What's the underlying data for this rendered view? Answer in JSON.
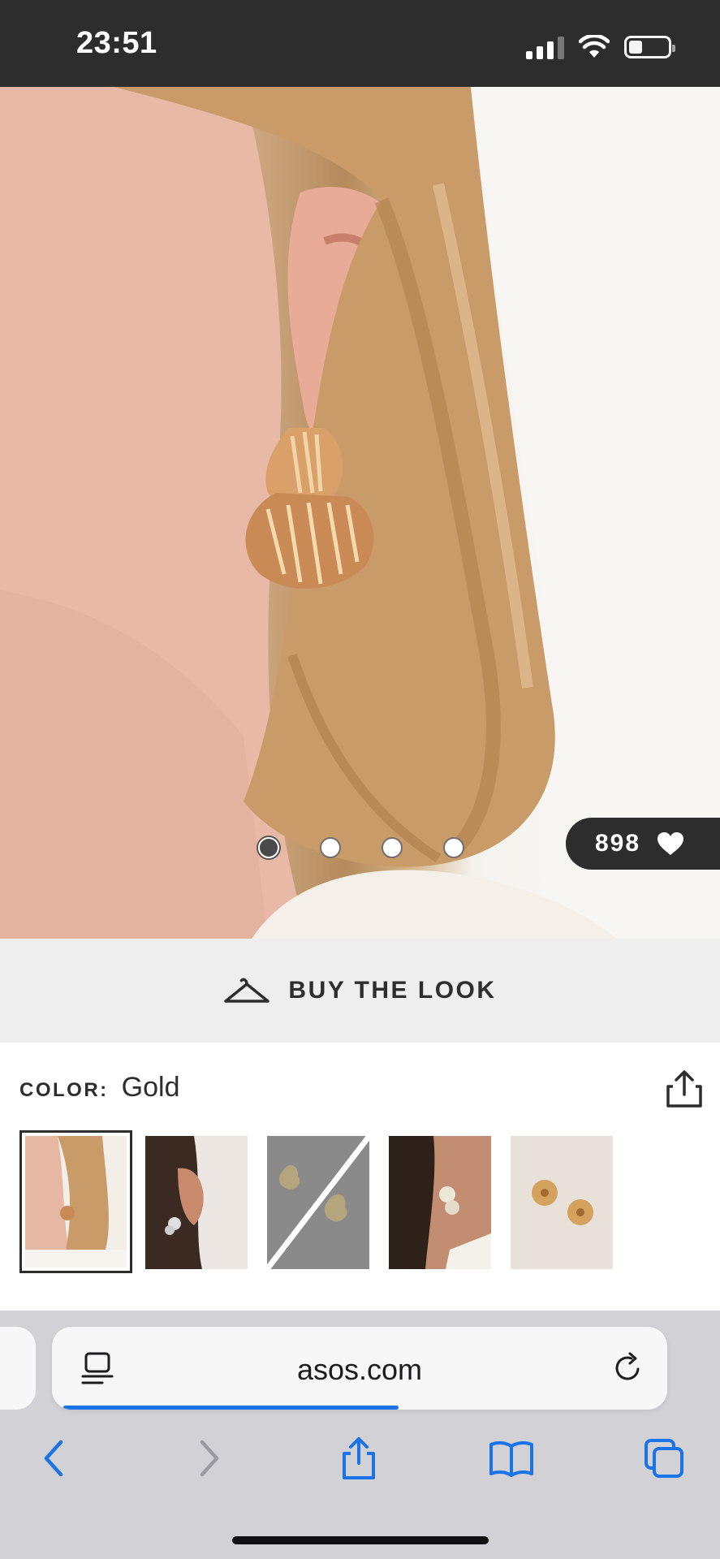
{
  "status_bar": {
    "time": "23:51",
    "icons": [
      "cellular-signal-icon",
      "wifi-icon",
      "battery-icon"
    ],
    "battery_level": 0.35
  },
  "product": {
    "gallery": {
      "image_count": 4,
      "active_index": 0
    },
    "likes": {
      "count": "898",
      "icon": "heart-icon"
    },
    "buy_the_look": {
      "label": "BUY THE LOOK",
      "icon": "hanger-icon"
    },
    "color": {
      "label": "COLOR:",
      "value": "Gold",
      "share_icon": "share-icon"
    },
    "swatches": [
      {
        "name": "gold-model",
        "selected": true
      },
      {
        "name": "silver-model",
        "selected": false
      },
      {
        "name": "unavailable",
        "selected": false
      },
      {
        "name": "pearl-model",
        "selected": false
      },
      {
        "name": "gold-flower",
        "selected": false
      }
    ]
  },
  "browser": {
    "url": "asos.com",
    "load_progress": 0.55,
    "toolbar": [
      "back-icon",
      "forward-icon",
      "share-icon",
      "bookmarks-icon",
      "tabs-icon"
    ]
  },
  "colors": {
    "dark": "#2d2d2d",
    "light_gray": "#eeeeee",
    "ios_blue": "#1a73e8"
  }
}
